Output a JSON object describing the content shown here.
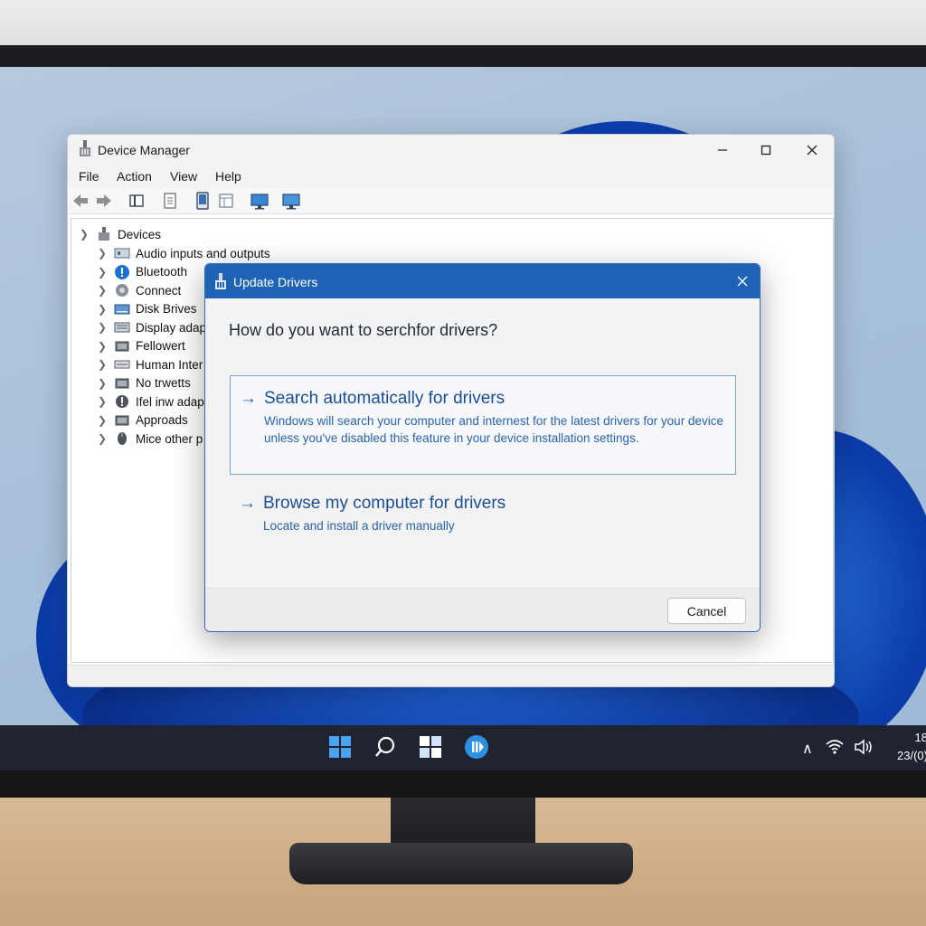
{
  "device_manager": {
    "title": "Device Manager",
    "menu": [
      "File",
      "Action",
      "View",
      "Help"
    ],
    "tree": {
      "root": "Devices",
      "items": [
        {
          "label": "Audio inputs and outputs",
          "icon": "audio-device-icon"
        },
        {
          "label": "Bluetooth",
          "icon": "bluetooth-icon"
        },
        {
          "label": "Connect",
          "icon": "connect-device-icon"
        },
        {
          "label": "Disk Brives",
          "icon": "disk-drive-icon"
        },
        {
          "label": "Display adap",
          "icon": "display-adapter-icon"
        },
        {
          "label": "Fellowert",
          "icon": "device-icon"
        },
        {
          "label": "Human Inter",
          "icon": "human-interface-icon"
        },
        {
          "label": "No trwetts",
          "icon": "device-icon"
        },
        {
          "label": "Ifel inw adap",
          "icon": "warning-device-icon"
        },
        {
          "label": "Approads",
          "icon": "device-icon"
        },
        {
          "label": "Mice other p",
          "icon": "mouse-icon"
        }
      ]
    }
  },
  "dialog": {
    "title": "Update Drivers",
    "question": "How do you want to serchfor drivers?",
    "option_auto": {
      "title": "Search automatically for drivers",
      "description": "Windows will search your computer and internest for the latest drivers for your device unless you've disabled this feature in your device installation settings."
    },
    "option_browse": {
      "title": "Browse my computer for drivers",
      "description": "Locate and install a driver manually"
    },
    "cancel_label": "Cancel"
  },
  "taskbar": {
    "time": "18",
    "date": "23/(0)"
  },
  "colors": {
    "accent": "#1e63b6",
    "link": "#1a4f93",
    "taskbar": "#1f2430"
  }
}
